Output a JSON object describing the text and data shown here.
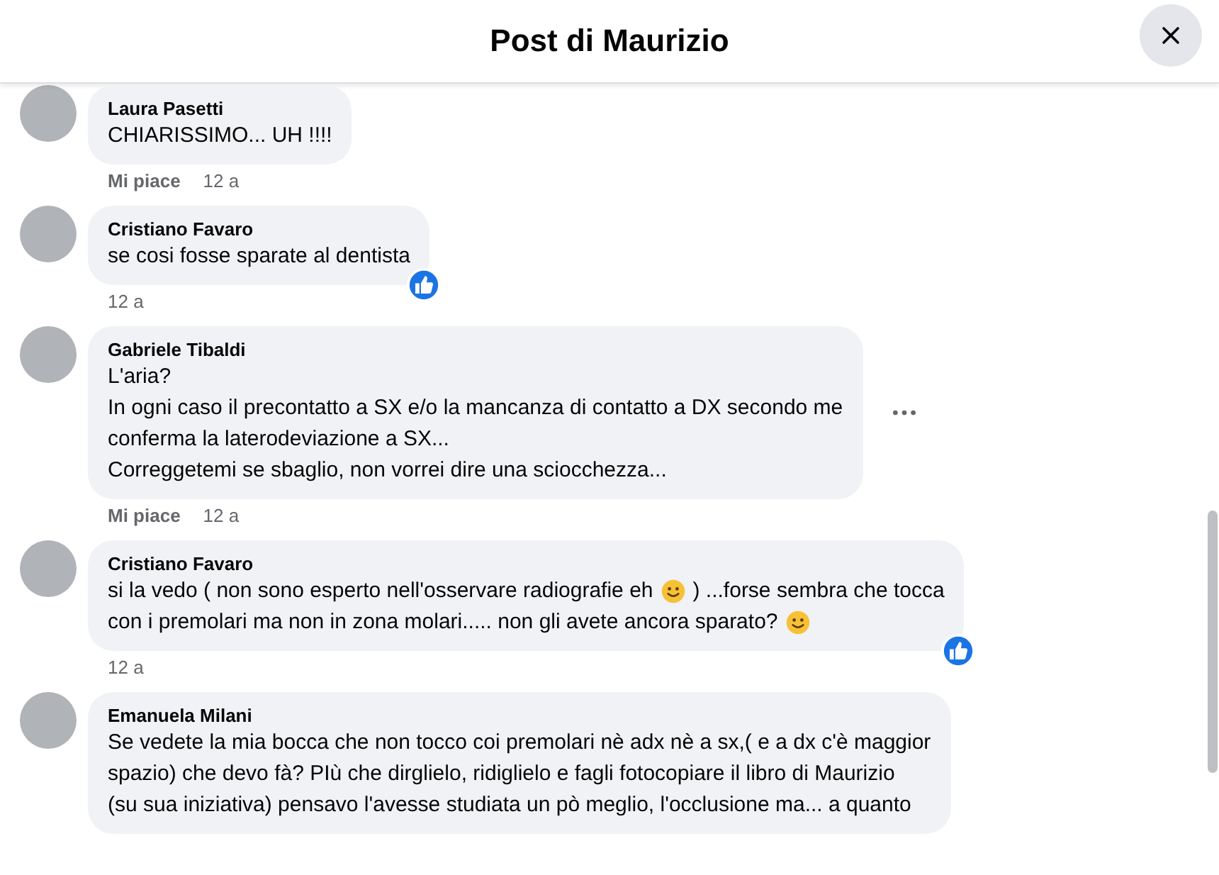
{
  "header": {
    "title": "Post di Maurizio"
  },
  "comments": [
    {
      "author": "Laura Pasetti",
      "lines": [
        [
          {
            "kind": "text",
            "value": "CHIARISSIMO... UH !!!!"
          }
        ]
      ],
      "like_link": "Mi piace",
      "time": "12 a",
      "reacted": false,
      "more_button": false
    },
    {
      "author": "Cristiano Favaro",
      "lines": [
        [
          {
            "kind": "text",
            "value": "se cosi fosse sparate al dentista"
          }
        ]
      ],
      "time": "12 a",
      "reacted": true,
      "more_button": false
    },
    {
      "author": "Gabriele Tibaldi",
      "lines": [
        [
          {
            "kind": "text",
            "value": "L'aria?"
          }
        ],
        [
          {
            "kind": "text",
            "value": "In ogni caso il precontatto a SX e/o la mancanza di contatto a DX secondo me"
          }
        ],
        [
          {
            "kind": "text",
            "value": "conferma la laterodeviazione a SX..."
          }
        ],
        [
          {
            "kind": "text",
            "value": "Correggetemi se sbaglio, non vorrei dire una sciocchezza..."
          }
        ]
      ],
      "like_link": "Mi piace",
      "time": "12 a",
      "reacted": false,
      "more_button": true
    },
    {
      "author": "Cristiano Favaro",
      "lines": [
        [
          {
            "kind": "text",
            "value": "si la vedo ( non sono esperto nell'osservare radiografie eh"
          },
          {
            "kind": "emoji"
          },
          {
            "kind": "text",
            "value": ") ...forse sembra che tocca"
          }
        ],
        [
          {
            "kind": "text",
            "value": "con i premolari ma non in zona molari..... non gli avete ancora sparato?"
          },
          {
            "kind": "emoji"
          }
        ]
      ],
      "time": "12 a",
      "reacted": true,
      "more_button": false
    },
    {
      "author": "Emanuela Milani",
      "lines": [
        [
          {
            "kind": "text",
            "value": "Se vedete la mia bocca che non tocco coi premolari nè adx nè a sx,( e a dx c'è maggior"
          }
        ],
        [
          {
            "kind": "text",
            "value": "spazio) che devo fà? PIù che dirglielo, ridiglielo e fagli fotocopiare il libro di Maurizio"
          }
        ],
        [
          {
            "kind": "text",
            "value": "(su sua iniziativa) pensavo l'avesse studiata un pò meglio, l'occlusione ma... a quanto"
          }
        ]
      ],
      "reacted": false,
      "more_button": false
    }
  ]
}
